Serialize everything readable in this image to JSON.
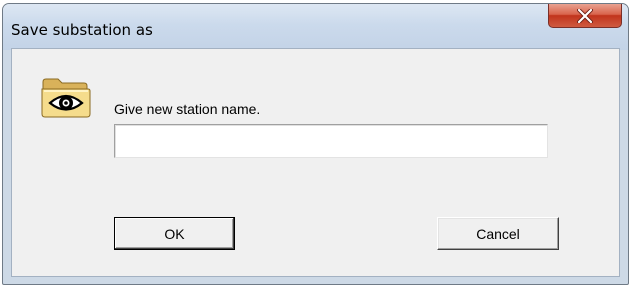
{
  "window": {
    "title": "Save substation as",
    "close_icon": "close-icon"
  },
  "dialog": {
    "icon": "folder-eye-icon",
    "prompt": "Give new station name.",
    "station_name_value": "",
    "station_name_placeholder": "",
    "ok_label": "OK",
    "cancel_label": "Cancel"
  },
  "colors": {
    "titlebar": "#cbdaec",
    "client_background": "#f0f0f0",
    "close_button": "#c9452b"
  }
}
